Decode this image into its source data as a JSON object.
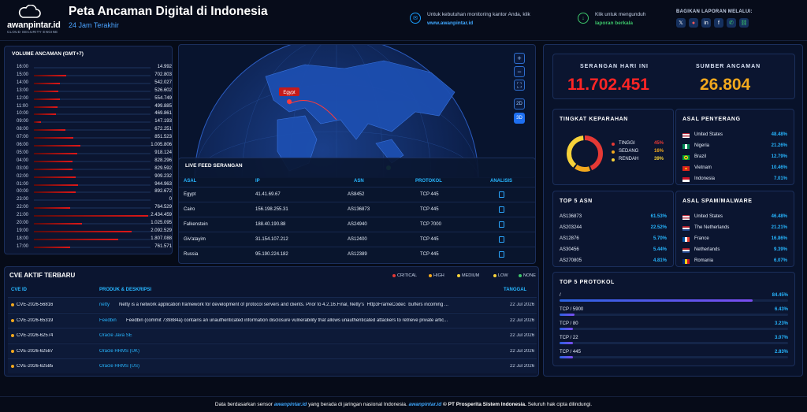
{
  "brand": {
    "name": "awanpintar.id",
    "tagline": "CLOUD SECURITY ENGINE"
  },
  "header": {
    "title": "Peta Ancaman Digital di Indonesia",
    "subtitle": "24 Jam Terakhir",
    "monitor_text": "Untuk kebutuhan monitoring kantor Anda, klik",
    "monitor_link": "www.awanpintar.id",
    "report_text": "Klik untuk mengunduh",
    "report_link": "laporan berkala",
    "share_label": "BAGIKAN LAPORAN MELALUI:",
    "share_icons": [
      "x-icon",
      "pinterest-icon",
      "linkedin-icon",
      "facebook-icon",
      "whatsapp-icon",
      "link-icon"
    ]
  },
  "volume": {
    "title": "VOLUME ANCAMAN (GMT+7)",
    "rows": [
      {
        "hour": "16:00",
        "value": "14.992",
        "level": 0.0
      },
      {
        "hour": "15:00",
        "value": "702.803",
        "level": 0.28
      },
      {
        "hour": "14:00",
        "value": "542.027",
        "level": 0.22
      },
      {
        "hour": "13:00",
        "value": "526.602",
        "level": 0.21
      },
      {
        "hour": "12:00",
        "value": "554.749",
        "level": 0.22
      },
      {
        "hour": "11:00",
        "value": "499.885",
        "level": 0.2
      },
      {
        "hour": "10:00",
        "value": "469.861",
        "level": 0.19
      },
      {
        "hour": "09:00",
        "value": "147.193",
        "level": 0.06
      },
      {
        "hour": "08:00",
        "value": "672.251",
        "level": 0.27
      },
      {
        "hour": "07:00",
        "value": "851.523",
        "level": 0.34
      },
      {
        "hour": "06:00",
        "value": "1.005.806",
        "level": 0.4
      },
      {
        "hour": "05:00",
        "value": "918.124",
        "level": 0.37
      },
      {
        "hour": "04:00",
        "value": "828.296",
        "level": 0.33
      },
      {
        "hour": "03:00",
        "value": "829.592",
        "level": 0.33
      },
      {
        "hour": "02:00",
        "value": "909.232",
        "level": 0.36
      },
      {
        "hour": "01:00",
        "value": "944.963",
        "level": 0.38
      },
      {
        "hour": "00:00",
        "value": "892.672",
        "level": 0.36
      },
      {
        "hour": "23:00",
        "value": "0",
        "level": 0.0
      },
      {
        "hour": "22:00",
        "value": "764.529",
        "level": 0.31
      },
      {
        "hour": "21:00",
        "value": "2.434.459",
        "level": 0.98
      },
      {
        "hour": "20:00",
        "value": "1.025.095",
        "level": 0.41
      },
      {
        "hour": "19:00",
        "value": "2.092.529",
        "level": 0.84
      },
      {
        "hour": "18:00",
        "value": "1.807.088",
        "level": 0.72
      },
      {
        "hour": "17:00",
        "value": "761.571",
        "level": 0.31
      }
    ]
  },
  "map": {
    "marker_label": "Egypt",
    "controls": [
      "+",
      "−",
      "⛶",
      "2D",
      "3D"
    ]
  },
  "feed": {
    "title": "LIVE FEED SERANGAN",
    "columns": [
      "ASAL",
      "IP",
      "ASN",
      "PROTOKOL",
      "ANALISIS"
    ],
    "rows": [
      {
        "asal": "Egypt",
        "ip": "41.41.69.67",
        "asn": "AS8452",
        "protokol": "TCP 445"
      },
      {
        "asal": "Cairo",
        "ip": "156.198.255.31",
        "asn": "AS136873",
        "protokol": "TCP 445"
      },
      {
        "asal": "Falkenstein",
        "ip": "188.40.190.88",
        "asn": "AS24940",
        "protokol": "TCP 7000"
      },
      {
        "asal": "Giv'atayim",
        "ip": "31.154.107.212",
        "asn": "AS12400",
        "protokol": "TCP 445"
      },
      {
        "asal": "Russia",
        "ip": "95.190.224.182",
        "asn": "AS12389",
        "protokol": "TCP 445"
      }
    ]
  },
  "cve": {
    "title": "CVE AKTIF TERBARU",
    "legend": [
      {
        "label": "CRITICAL",
        "color": "#e53935"
      },
      {
        "label": "HIGH",
        "color": "#f2a81d"
      },
      {
        "label": "MEDIUM",
        "color": "#f7d23a"
      },
      {
        "label": "LOW",
        "color": "#f7d23a"
      },
      {
        "label": "NONE",
        "color": "#3cc46a"
      }
    ],
    "columns": [
      "CVE ID",
      "PRODUK & DESKRIPSI",
      "TANGGAL"
    ],
    "rows": [
      {
        "id": "CVE-2026-56816",
        "product": "netty",
        "desc": "Netty is a network application framework for development of protocol servers and clients. Prior to 4.2.16.Final, Netty's `Http3FrameCodec` buffers incoming ...",
        "date": "22 Jul 2026"
      },
      {
        "id": "CVE-2026-65319",
        "product": "Feedbin",
        "desc": "Feedbin (commit 739884a) contains an unauthenticated information disclosure vulnerability that allows unauthenticated attackers to retrieve private artic...",
        "date": "22 Jul 2026"
      },
      {
        "id": "CVE-2026-62574",
        "product": "Oracle Java SE",
        "desc": "",
        "date": "22 Jul 2026"
      },
      {
        "id": "CVE-2026-62587",
        "product": "Oracle HRMS (UK)",
        "desc": "",
        "date": "22 Jul 2026"
      },
      {
        "id": "CVE-2026-62585",
        "product": "Oracle HRMS (US)",
        "desc": "",
        "date": "22 Jul 2026"
      }
    ]
  },
  "stats": {
    "attacks_label": "SERANGAN HARI INI",
    "attacks_value": "11.702.451",
    "sources_label": "SUMBER ANCAMAN",
    "sources_value": "26.804"
  },
  "severity": {
    "title": "TINGKAT KEPARAHAN",
    "items": [
      {
        "label": "TINGGI",
        "pct": "45%",
        "value": 45,
        "color": "#e53935"
      },
      {
        "label": "SEDANG",
        "pct": "16%",
        "value": 16,
        "color": "#f2a81d"
      },
      {
        "label": "RENDAH",
        "pct": "39%",
        "value": 39,
        "color": "#f7d23a"
      }
    ]
  },
  "attackers": {
    "title": "ASAL PENYERANG",
    "rows": [
      {
        "country": "United States",
        "pct": "48.48%"
      },
      {
        "country": "Nigeria",
        "pct": "21.26%"
      },
      {
        "country": "Brazil",
        "pct": "12.79%"
      },
      {
        "country": "Vietnam",
        "pct": "10.46%"
      },
      {
        "country": "Indonesia",
        "pct": "7.01%"
      }
    ]
  },
  "asn": {
    "title": "TOP 5 ASN",
    "rows": [
      {
        "name": "AS136873",
        "pct": "61.53%"
      },
      {
        "name": "AS203244",
        "pct": "22.52%"
      },
      {
        "name": "AS12876",
        "pct": "5.70%"
      },
      {
        "name": "AS30456",
        "pct": "5.44%"
      },
      {
        "name": "AS270805",
        "pct": "4.81%"
      }
    ]
  },
  "spam": {
    "title": "ASAL SPAM/MALWARE",
    "rows": [
      {
        "country": "United States",
        "pct": "46.48%"
      },
      {
        "country": "The Netherlands",
        "pct": "21.21%"
      },
      {
        "country": "France",
        "pct": "16.86%"
      },
      {
        "country": "Netherlands",
        "pct": "9.39%"
      },
      {
        "country": "Romania",
        "pct": "6.07%"
      }
    ]
  },
  "protocols": {
    "title": "TOP 5 PROTOKOL",
    "rows": [
      {
        "name": "/",
        "pct": "84.45%",
        "value": 84.45
      },
      {
        "name": "TCP / 5900",
        "pct": "6.43%",
        "value": 6.43
      },
      {
        "name": "TCP / 80",
        "pct": "3.23%",
        "value": 3.23
      },
      {
        "name": "TCP / 22",
        "pct": "3.07%",
        "value": 3.07
      },
      {
        "name": "TCP / 445",
        "pct": "2.83%",
        "value": 2.83
      }
    ]
  },
  "footer": {
    "pre": "Data berdasarkan sensor",
    "brand": "awanpintar.id",
    "mid": "yang berada di jaringan nasional Indonesia.",
    "brand2": "awanpintar.id",
    "company": "© PT Prosperita Sistem Indonesia.",
    "rights": "Seluruh hak cipta dilindungi."
  }
}
